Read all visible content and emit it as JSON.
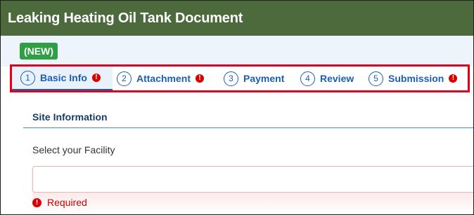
{
  "window": {
    "title": "Leaking Heating Oil Tank Document"
  },
  "status_badge": "(NEW)",
  "steps": [
    {
      "number": "1",
      "label": "Basic Info",
      "has_error": true,
      "active": true
    },
    {
      "number": "2",
      "label": "Attachment",
      "has_error": true,
      "active": false
    },
    {
      "number": "3",
      "label": "Payment",
      "has_error": false,
      "active": false
    },
    {
      "number": "4",
      "label": "Review",
      "has_error": false,
      "active": false
    },
    {
      "number": "5",
      "label": "Submission",
      "has_error": true,
      "active": false
    }
  ],
  "section": {
    "title": "Site Information"
  },
  "facility_field": {
    "label": "Select your Facility",
    "value": "",
    "placeholder": ""
  },
  "validation": {
    "required_text": "Required",
    "error_symbol": "!"
  },
  "colors": {
    "header": "#4c6a3c",
    "accent": "#1a5fb4",
    "error": "#d90000",
    "badge": "#2f9e44",
    "highlight_frame": "#e3001b"
  },
  "icons": {
    "error": "exclamation-circle-icon"
  }
}
